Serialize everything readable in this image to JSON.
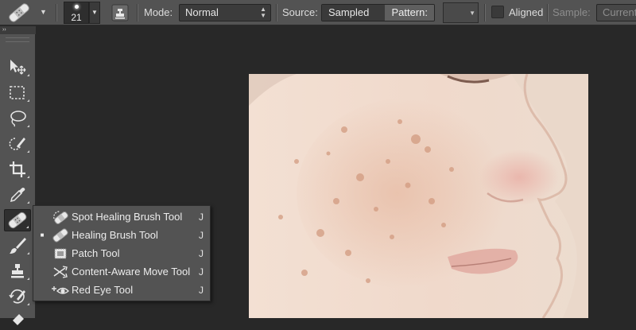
{
  "options_bar": {
    "tool_icon": "healing-brush-icon",
    "brush_size": "21",
    "mode_label": "Mode:",
    "mode_value": "Normal",
    "source_label": "Source:",
    "source_options": [
      "Sampled",
      "Pattern:"
    ],
    "source_selected": "Sampled",
    "aligned_label": "Aligned",
    "aligned_checked": false,
    "sample_label": "Sample:",
    "sample_value": "Current"
  },
  "toolbar": {
    "collapse_glyph": "››",
    "tools": [
      {
        "name": "move-tool",
        "icon": "move-icon"
      },
      {
        "name": "marquee-tool",
        "icon": "marquee-icon"
      },
      {
        "name": "lasso-tool",
        "icon": "lasso-icon"
      },
      {
        "name": "quick-selection-tool",
        "icon": "quick-selection-icon"
      },
      {
        "name": "crop-tool",
        "icon": "crop-icon"
      },
      {
        "name": "eyedropper-tool",
        "icon": "eyedropper-icon"
      },
      {
        "name": "healing-brush-tool",
        "icon": "bandage-icon",
        "active": true
      },
      {
        "name": "brush-tool",
        "icon": "brush-icon"
      },
      {
        "name": "clone-stamp-tool",
        "icon": "stamp-icon"
      },
      {
        "name": "history-brush-tool",
        "icon": "history-brush-icon"
      },
      {
        "name": "eraser-tool",
        "icon": "eraser-icon"
      }
    ]
  },
  "flyout_menu": {
    "items": [
      {
        "label": "Spot Healing Brush Tool",
        "shortcut": "J",
        "icon": "spot-healing-icon",
        "selected": false
      },
      {
        "label": "Healing Brush Tool",
        "shortcut": "J",
        "icon": "bandage-icon",
        "selected": true
      },
      {
        "label": "Patch Tool",
        "shortcut": "J",
        "icon": "patch-icon",
        "selected": false
      },
      {
        "label": "Content-Aware Move Tool",
        "shortcut": "J",
        "icon": "content-aware-move-icon",
        "selected": false
      },
      {
        "label": "Red Eye Tool",
        "shortcut": "J",
        "icon": "red-eye-icon",
        "selected": false
      }
    ],
    "selected_bullet": "■"
  },
  "colors": {
    "panel": "#535353",
    "workspace": "#282828",
    "skin": "#efdbcd",
    "blemish": "#d9a68c"
  }
}
